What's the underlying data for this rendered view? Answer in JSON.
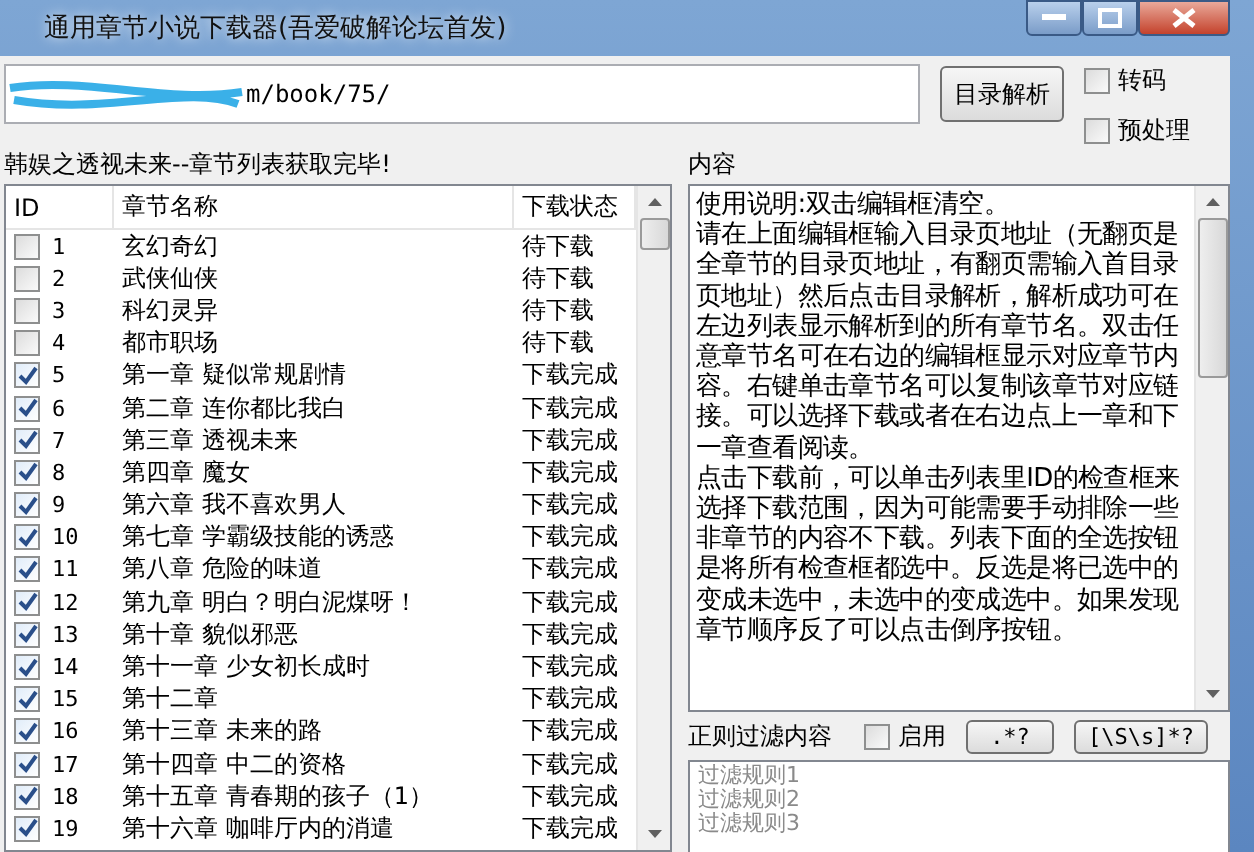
{
  "window": {
    "title": "通用章节小说下载器(吾爱破解论坛首发)"
  },
  "url_field": {
    "value": "m/book/75/"
  },
  "parse_button": "目录解析",
  "options": [
    {
      "label": "转码",
      "checked": false
    },
    {
      "label": "预处理",
      "checked": false
    }
  ],
  "status_text": "韩娱之透视未来--章节列表获取完毕!",
  "content_label": "内容",
  "table": {
    "columns": [
      "ID",
      "章节名称",
      "下载状态"
    ],
    "rows": [
      {
        "id": "1",
        "name": "玄幻奇幻",
        "status": "待下载",
        "checked": false
      },
      {
        "id": "2",
        "name": "武侠仙侠",
        "status": "待下载",
        "checked": false
      },
      {
        "id": "3",
        "name": "科幻灵异",
        "status": "待下载",
        "checked": false
      },
      {
        "id": "4",
        "name": "都市职场",
        "status": "待下载",
        "checked": false
      },
      {
        "id": "5",
        "name": "第一章 疑似常规剧情",
        "status": "下载完成",
        "checked": true
      },
      {
        "id": "6",
        "name": "第二章 连你都比我白",
        "status": "下载完成",
        "checked": true
      },
      {
        "id": "7",
        "name": "第三章 透视未来",
        "status": "下载完成",
        "checked": true
      },
      {
        "id": "8",
        "name": "第四章 魔女",
        "status": "下载完成",
        "checked": true
      },
      {
        "id": "9",
        "name": "第六章 我不喜欢男人",
        "status": "下载完成",
        "checked": true
      },
      {
        "id": "10",
        "name": "第七章 学霸级技能的诱惑",
        "status": "下载完成",
        "checked": true
      },
      {
        "id": "11",
        "name": "第八章 危险的味道",
        "status": "下载完成",
        "checked": true
      },
      {
        "id": "12",
        "name": "第九章 明白？明白泥煤呀！",
        "status": "下载完成",
        "checked": true
      },
      {
        "id": "13",
        "name": "第十章 貌似邪恶",
        "status": "下载完成",
        "checked": true
      },
      {
        "id": "14",
        "name": "第十一章 少女初长成时",
        "status": "下载完成",
        "checked": true
      },
      {
        "id": "15",
        "name": "第十二章",
        "status": "下载完成",
        "checked": true
      },
      {
        "id": "16",
        "name": "第十三章 未来的路",
        "status": "下载完成",
        "checked": true
      },
      {
        "id": "17",
        "name": "第十四章 中二的资格",
        "status": "下载完成",
        "checked": true
      },
      {
        "id": "18",
        "name": "第十五章 青春期的孩子（1）",
        "status": "下载完成",
        "checked": true
      },
      {
        "id": "19",
        "name": "第十六章 咖啡厅内的消遣",
        "status": "下载完成",
        "checked": true
      }
    ]
  },
  "content_paragraphs": [
    "使用说明:双击编辑框清空。",
    "请在上面编辑框输入目录页地址（无翻页是全章节的目录页地址，有翻页需输入首目录页地址）然后点击目录解析，解析成功可在左边列表显示解析到的所有章节名。双击任意章节名可在右边的编辑框显示对应章节内容。右键单击章节名可以复制该章节对应链接。可以选择下载或者在右边点上一章和下一章查看阅读。",
    "点击下载前，可以单击列表里ID的检查框来选择下载范围，因为可能需要手动排除一些非章节的内容不下载。列表下面的全选按钮是将所有检查框都选中。反选是将已选中的变成未选中，未选中的变成选中。如果发现章节顺序反了可以点击倒序按钮。"
  ],
  "filter": {
    "label": "正则过滤内容",
    "enable": {
      "label": "启用",
      "checked": false
    },
    "buttons": [
      ".*?",
      "[\\S\\s]*?"
    ],
    "rules": [
      "过滤规则1",
      "过滤规则2",
      "过滤规则3"
    ]
  }
}
